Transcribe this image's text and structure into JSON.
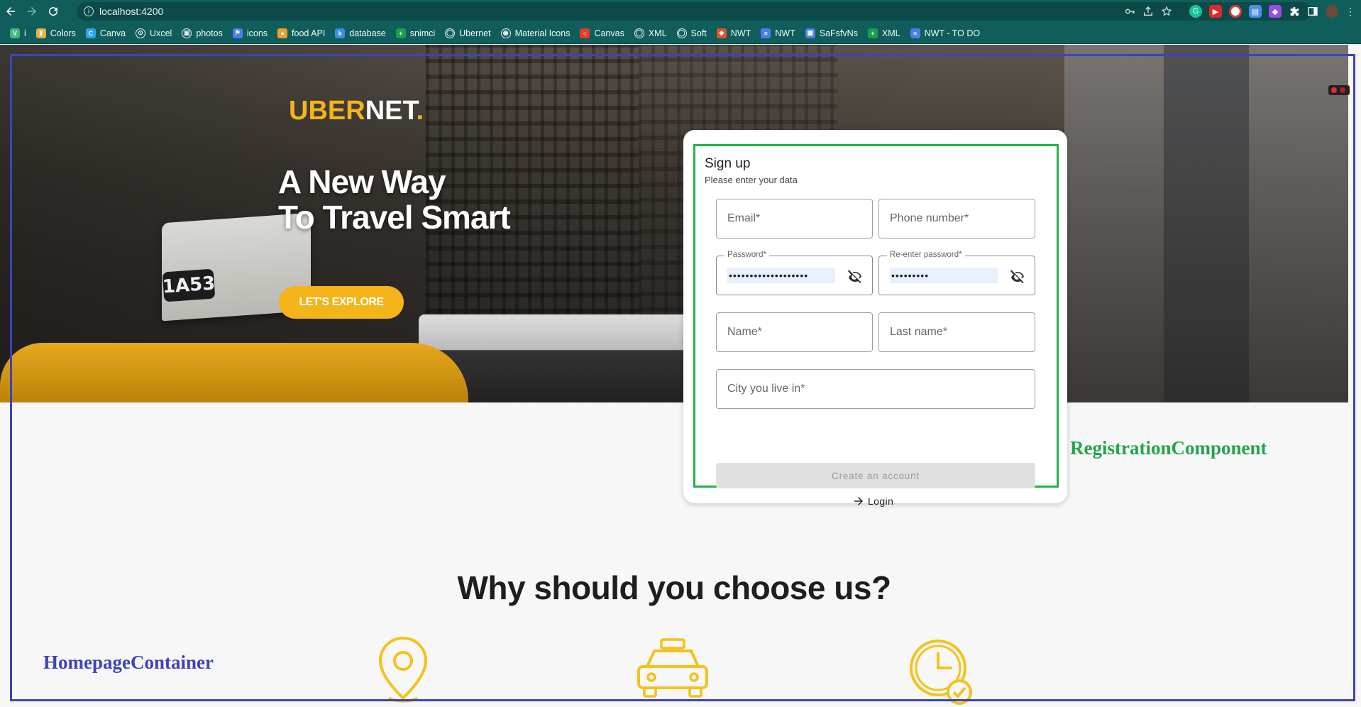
{
  "browser": {
    "url": "localhost:4200",
    "bookmarks": [
      {
        "label": "i",
        "icon": "vue-icon",
        "color": "#41b883"
      },
      {
        "label": "Colors",
        "icon": "bucket-icon",
        "color": "#e8b33a"
      },
      {
        "label": "Canva",
        "icon": "canva-icon",
        "color": "#2aa4e6"
      },
      {
        "label": "Uxcel",
        "icon": "uxcel-icon",
        "color": "#ffffff"
      },
      {
        "label": "photos",
        "icon": "camera-icon",
        "color": "#222222"
      },
      {
        "label": "icons",
        "icon": "flag-icon",
        "color": "#4c7cf0"
      },
      {
        "label": "food API",
        "icon": "food-icon",
        "color": "#f0a030"
      },
      {
        "label": "database",
        "icon": "k-icon",
        "color": "#3a8ee6"
      },
      {
        "label": "snimci",
        "icon": "plus-sheet-icon",
        "color": "#1e9e4a"
      },
      {
        "label": "Ubernet",
        "icon": "github-icon",
        "color": "#222222"
      },
      {
        "label": "Material Icons",
        "icon": "compass-icon",
        "color": "#ffffff"
      },
      {
        "label": "Canvas",
        "icon": "ring-icon",
        "color": "#e0402a"
      },
      {
        "label": "XML",
        "icon": "github-icon",
        "color": "#222222"
      },
      {
        "label": "Soft",
        "icon": "github-icon",
        "color": "#222222"
      },
      {
        "label": "NWT",
        "icon": "gitlab-icon",
        "color": "#e2532a"
      },
      {
        "label": "NWT",
        "icon": "doc-icon",
        "color": "#4c7cf0"
      },
      {
        "label": "SaFsfvNs",
        "icon": "image-icon",
        "color": "#4c7cf0"
      },
      {
        "label": "XML",
        "icon": "plus-sheet-icon",
        "color": "#1e9e4a"
      },
      {
        "label": "NWT - TO DO",
        "icon": "doc-icon",
        "color": "#4c7cf0"
      }
    ]
  },
  "hero": {
    "logo_part1": "UBER",
    "logo_part2": "NET",
    "logo_part3": ".",
    "headline_line1": "A New Way",
    "headline_line2": "To Travel Smart",
    "explore_label": "LET'S EXPLORE",
    "taxi_number": "1A53"
  },
  "signup": {
    "title": "Sign up",
    "subtitle": "Please enter your data",
    "email_placeholder": "Email*",
    "phone_placeholder": "Phone number*",
    "password_label": "Password*",
    "password_value": "•••••••••••••••••••",
    "reenter_label": "Re-enter password*",
    "reenter_value": "•••••••••",
    "name_placeholder": "Name*",
    "lastname_placeholder": "Last name*",
    "city_placeholder": "City you live in*",
    "create_label": "Create an account",
    "login_label": "Login"
  },
  "annotations": {
    "registration": "RegistrationComponent",
    "homepage": "HomepageContainer"
  },
  "section": {
    "why_title": "Why should you choose us?"
  },
  "colors": {
    "accent": "#f4b41a",
    "registration_frame": "#21b24a",
    "homepage_frame": "#3c44b8",
    "browser_bar": "#0f5e5b"
  }
}
